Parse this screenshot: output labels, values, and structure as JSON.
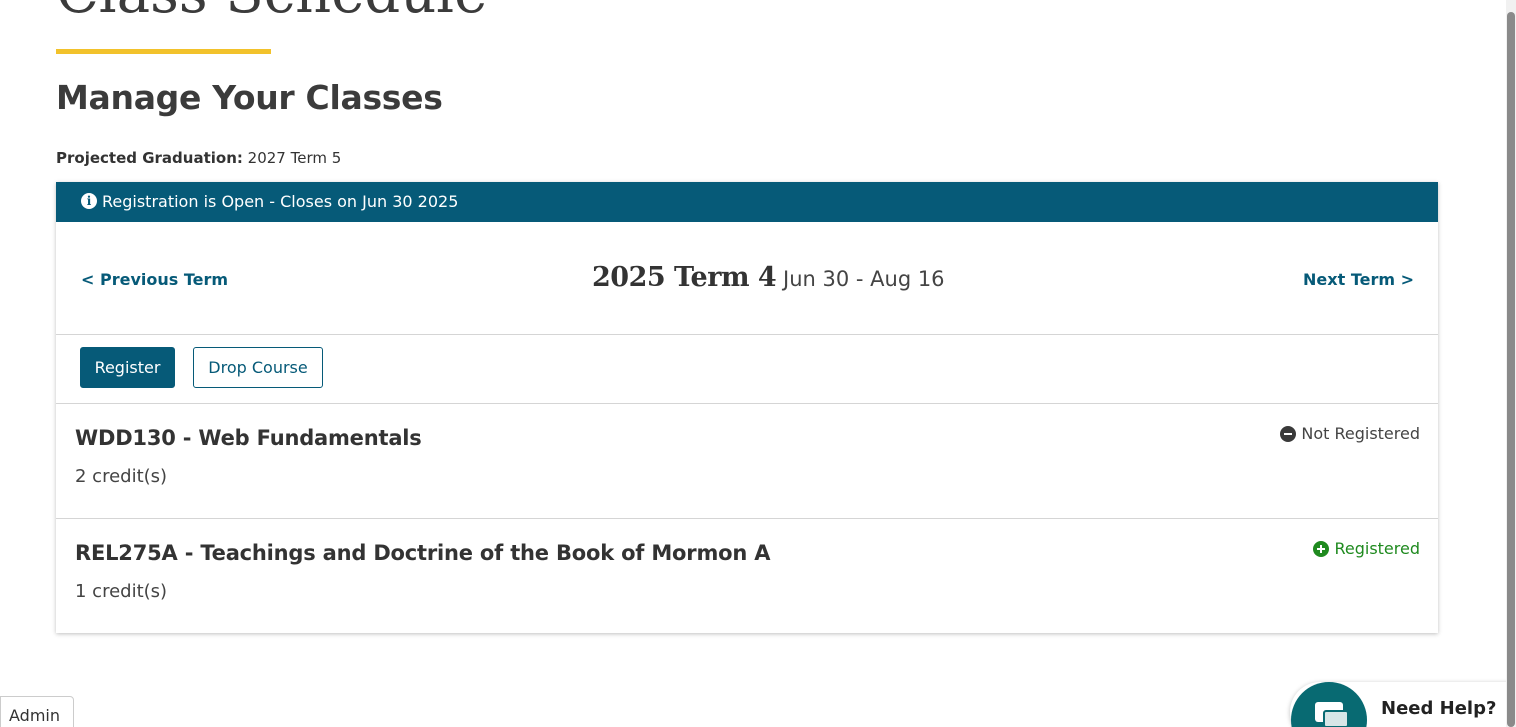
{
  "page": {
    "title": "Class Schedule",
    "heading": "Manage Your Classes",
    "projected_label": "Projected Graduation:",
    "projected_value": "2027 Term 5"
  },
  "banner": {
    "icon": "info-circle-icon",
    "text": "Registration is Open - Closes on Jun 30 2025"
  },
  "term_nav": {
    "prev_label": "< Previous Term",
    "term_name": "2025 Term 4",
    "term_dates": "Jun 30 - Aug 16",
    "next_label": "Next Term >"
  },
  "actions": {
    "register_label": "Register",
    "drop_label": "Drop Course"
  },
  "courses": [
    {
      "title": "WDD130 - Web Fundamentals",
      "credits": "2 credit(s)",
      "status": "Not Registered",
      "status_icon": "minus-circle-icon",
      "status_color": "#444444"
    },
    {
      "title": "REL275A - Teachings and Doctrine of the Book of Mormon A",
      "credits": "1 credit(s)",
      "status": "Registered",
      "status_icon": "plus-circle-icon",
      "status_color": "#1f8a1f"
    }
  ],
  "footer": {
    "admin_label": "Admin",
    "help_label": "Need Help?",
    "help_icon": "chat-bubbles-icon"
  },
  "colors": {
    "primary": "#065a78",
    "accent": "#f2c22b",
    "help": "#086a72"
  }
}
